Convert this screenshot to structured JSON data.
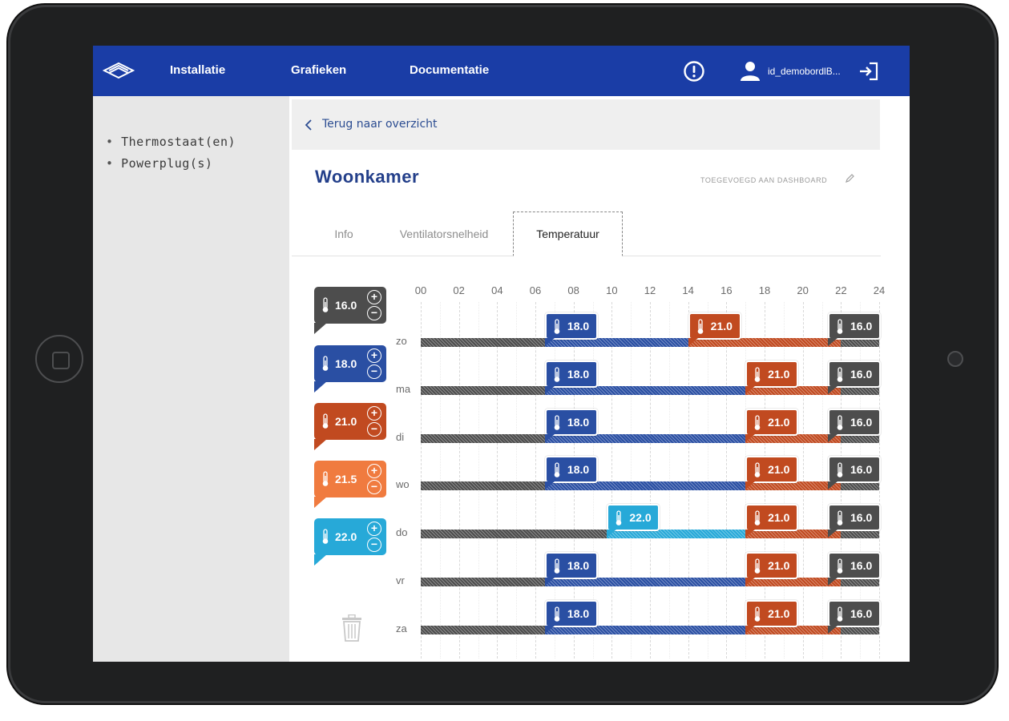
{
  "nav": {
    "items": [
      "Installatie",
      "Grafieken",
      "Documentatie"
    ],
    "username": "id_demobordlB...",
    "logo_icon": "brand-logo-icon",
    "alert_icon": "alert-circle-icon",
    "user_icon": "user-icon",
    "logout_icon": "logout-icon"
  },
  "sidebar": {
    "items": [
      "Thermostaat(en)",
      "Powerplug(s)"
    ]
  },
  "back": {
    "label": "Terug naar overzicht"
  },
  "page": {
    "title": "Woonkamer",
    "dashboard_link": "TOEGEVOEGD AAN DASHBOARD"
  },
  "tabs": [
    "Info",
    "Ventilatorsnelheid",
    "Temperatuur"
  ],
  "active_tab": "Temperatuur",
  "palette": [
    {
      "value": "16.0",
      "color": "#4d4d4d"
    },
    {
      "value": "18.0",
      "color": "#2a4fa3"
    },
    {
      "value": "21.0",
      "color": "#c14a20"
    },
    {
      "value": "21.5",
      "color": "#f07b3f"
    },
    {
      "value": "22.0",
      "color": "#27a9d8"
    }
  ],
  "palette_controls": {
    "plus": "+",
    "minus": "−"
  },
  "colors": {
    "16.0": "#4d4d4d",
    "18.0": "#2a4fa3",
    "21.0": "#c14a20",
    "21.5": "#f07b3f",
    "22.0": "#27a9d8",
    "nav_bg": "#1a3da6"
  },
  "chart_data": {
    "type": "schedule",
    "x_ticks": [
      "00",
      "02",
      "04",
      "06",
      "08",
      "10",
      "12",
      "14",
      "16",
      "18",
      "20",
      "22",
      "24"
    ],
    "xlim": [
      0,
      24
    ],
    "days": [
      {
        "label": "zo",
        "segments": [
          {
            "start": 0,
            "end": 6.5,
            "temp": "16.0"
          },
          {
            "start": 6.5,
            "end": 14,
            "temp": "18.0"
          },
          {
            "start": 14,
            "end": 22,
            "temp": "21.0"
          },
          {
            "start": 22,
            "end": 24,
            "temp": "16.0"
          }
        ]
      },
      {
        "label": "ma",
        "segments": [
          {
            "start": 0,
            "end": 6.5,
            "temp": "16.0"
          },
          {
            "start": 6.5,
            "end": 17,
            "temp": "18.0"
          },
          {
            "start": 17,
            "end": 22,
            "temp": "21.0"
          },
          {
            "start": 22,
            "end": 24,
            "temp": "16.0"
          }
        ]
      },
      {
        "label": "di",
        "segments": [
          {
            "start": 0,
            "end": 6.5,
            "temp": "16.0"
          },
          {
            "start": 6.5,
            "end": 17,
            "temp": "18.0"
          },
          {
            "start": 17,
            "end": 22,
            "temp": "21.0"
          },
          {
            "start": 22,
            "end": 24,
            "temp": "16.0"
          }
        ]
      },
      {
        "label": "wo",
        "segments": [
          {
            "start": 0,
            "end": 6.5,
            "temp": "16.0"
          },
          {
            "start": 6.5,
            "end": 17,
            "temp": "18.0"
          },
          {
            "start": 17,
            "end": 22,
            "temp": "21.0"
          },
          {
            "start": 22,
            "end": 24,
            "temp": "16.0"
          }
        ]
      },
      {
        "label": "do",
        "segments": [
          {
            "start": 0,
            "end": 9.75,
            "temp": "16.0"
          },
          {
            "start": 9.75,
            "end": 17,
            "temp": "22.0"
          },
          {
            "start": 17,
            "end": 22,
            "temp": "21.0"
          },
          {
            "start": 22,
            "end": 24,
            "temp": "16.0"
          }
        ]
      },
      {
        "label": "vr",
        "segments": [
          {
            "start": 0,
            "end": 6.5,
            "temp": "16.0"
          },
          {
            "start": 6.5,
            "end": 17,
            "temp": "18.0"
          },
          {
            "start": 17,
            "end": 22,
            "temp": "21.0"
          },
          {
            "start": 22,
            "end": 24,
            "temp": "16.0"
          }
        ]
      },
      {
        "label": "za",
        "segments": [
          {
            "start": 0,
            "end": 6.5,
            "temp": "16.0"
          },
          {
            "start": 6.5,
            "end": 17,
            "temp": "18.0"
          },
          {
            "start": 17,
            "end": 22,
            "temp": "21.0"
          },
          {
            "start": 22,
            "end": 24,
            "temp": "16.0"
          }
        ]
      }
    ]
  },
  "trash_icon": "trash-icon"
}
